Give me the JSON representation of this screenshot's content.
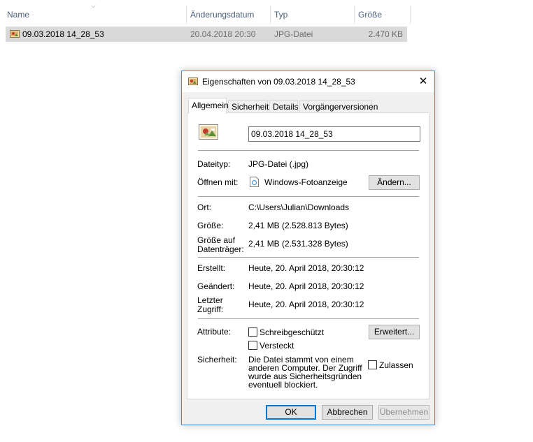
{
  "explorer": {
    "columns": {
      "name": "Name",
      "date": "Änderungsdatum",
      "type": "Typ",
      "size": "Größe"
    },
    "file": {
      "name": "09.03.2018 14_28_53",
      "date": "20.04.2018 20:30",
      "type": "JPG-Datei",
      "size": "2.470 KB"
    }
  },
  "dialog": {
    "title": "Eigenschaften von 09.03.2018 14_28_53",
    "close_glyph": "✕",
    "tabs": [
      "Allgemein",
      "Sicherheit",
      "Details",
      "Vorgängerversionen"
    ],
    "general": {
      "filename_value": "09.03.2018 14_28_53",
      "filetype_label": "Dateityp:",
      "filetype_value": "JPG-Datei (.jpg)",
      "opens_with_label": "Öffnen mit:",
      "opens_with_value": "Windows-Fotoanzeige",
      "change_button": "Ändern...",
      "location_label": "Ort:",
      "location_value": "C:\\Users\\Julian\\Downloads",
      "size_label": "Größe:",
      "size_value": "2,41 MB (2.528.813 Bytes)",
      "size_on_disk_label_1": "Größe auf",
      "size_on_disk_label_2": "Datenträger:",
      "size_on_disk_value": "2,41 MB (2.531.328 Bytes)",
      "created_label": "Erstellt:",
      "created_value": "Heute, 20. April 2018, 20:30:12",
      "modified_label": "Geändert:",
      "modified_value": "Heute, 20. April 2018, 20:30:12",
      "accessed_label_1": "Letzter",
      "accessed_label_2": "Zugriff:",
      "accessed_value": "Heute, 20. April 2018, 20:30:12",
      "attributes_label": "Attribute:",
      "readonly_label": "Schreibgeschützt",
      "hidden_label": "Versteckt",
      "advanced_button": "Erweitert...",
      "security_label": "Sicherheit:",
      "security_text_1": "Die Datei stammt von einem",
      "security_text_2": "anderen Computer. Der Zugriff",
      "security_text_3": "wurde aus Sicherheitsgründen",
      "security_text_4": "eventuell blockiert.",
      "unblock_label": "Zulassen"
    },
    "buttons": {
      "ok": "OK",
      "cancel": "Abbrechen",
      "apply": "Übernehmen"
    }
  }
}
